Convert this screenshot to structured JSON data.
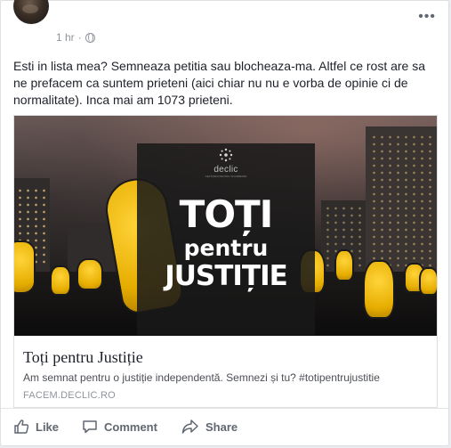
{
  "post": {
    "timestamp": "1 hr",
    "separator": "·",
    "privacy_icon": "globe-icon",
    "menu_icon": "more-horizontal-icon",
    "menu_glyph": "•••",
    "text": "Esti in lista mea? Semneaza petitia sau blocheaza-ma. Altfel ce rost are sa ne prefacem ca suntem prieteni (aici chiar nu nu e vorba de opinie ci de normalitate). Inca mai am 1073 prieteni."
  },
  "link_preview": {
    "image": {
      "logo_name": "declic",
      "logo_tagline": "CETĂȚENI PENTRU SCHIMBARE",
      "banner_line1": "TOȚI",
      "banner_line2": "pentru",
      "banner_line3": "JUSTIȚIE"
    },
    "title": "Toți pentru Justiție",
    "description": "Am semnat pentru o justiție independentă. Semnezi și tu? #totipentrujustitie",
    "domain": "FACEM.DECLIC.RO"
  },
  "actions": {
    "like": {
      "label": "Like",
      "icon": "thumbs-up-icon"
    },
    "comment": {
      "label": "Comment",
      "icon": "comment-icon"
    },
    "share": {
      "label": "Share",
      "icon": "share-icon"
    }
  },
  "colors": {
    "card_border": "#dddfe2",
    "text_primary": "#1d2129",
    "text_secondary": "#90949c",
    "action_text": "#606770",
    "sign_yellow": "#ffd43a"
  }
}
